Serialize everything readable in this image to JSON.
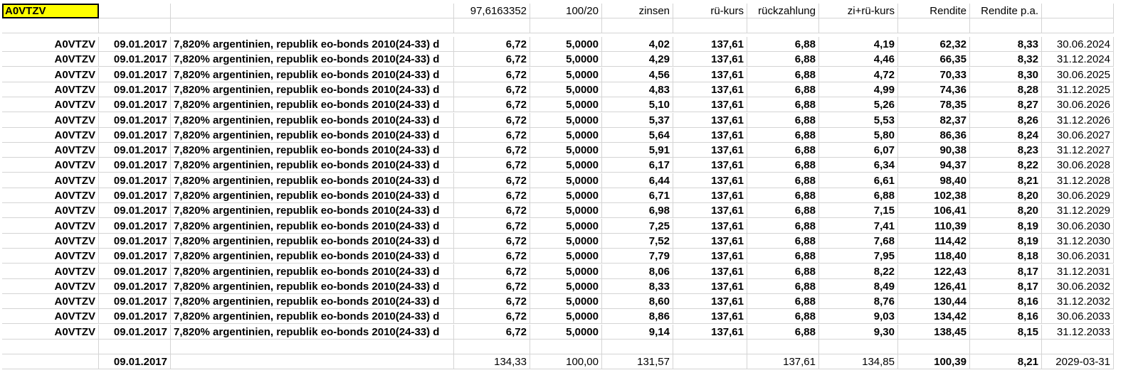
{
  "header": {
    "cells": [
      "A0VTZV",
      "",
      "",
      "97,6163352",
      "100/20",
      "zinsen",
      "rü-kurs",
      "rückzahlung",
      "zi+rü-kurs",
      "Rendite",
      "Rendite p.a.",
      ""
    ],
    "active_cell_fill": "#ffff00"
  },
  "row_template": {
    "wkn": "A0VTZV",
    "date": "09.01.2017",
    "name": "7,820% argentinien, republik eo-bonds 2010(24-33) d",
    "kurs": "6,72",
    "ratio": "5,0000",
    "rue_kurs": "137,61",
    "rueckzahlung": "6,88"
  },
  "rows": [
    {
      "zinsen": "4,02",
      "zi_rue": "4,19",
      "rendite": "62,32",
      "rendite_pa": "8,33",
      "datum": "30.06.2024"
    },
    {
      "zinsen": "4,29",
      "zi_rue": "4,46",
      "rendite": "66,35",
      "rendite_pa": "8,32",
      "datum": "31.12.2024"
    },
    {
      "zinsen": "4,56",
      "zi_rue": "4,72",
      "rendite": "70,33",
      "rendite_pa": "8,30",
      "datum": "30.06.2025"
    },
    {
      "zinsen": "4,83",
      "zi_rue": "4,99",
      "rendite": "74,36",
      "rendite_pa": "8,28",
      "datum": "31.12.2025"
    },
    {
      "zinsen": "5,10",
      "zi_rue": "5,26",
      "rendite": "78,35",
      "rendite_pa": "8,27",
      "datum": "30.06.2026"
    },
    {
      "zinsen": "5,37",
      "zi_rue": "5,53",
      "rendite": "82,37",
      "rendite_pa": "8,26",
      "datum": "31.12.2026"
    },
    {
      "zinsen": "5,64",
      "zi_rue": "5,80",
      "rendite": "86,36",
      "rendite_pa": "8,24",
      "datum": "30.06.2027"
    },
    {
      "zinsen": "5,91",
      "zi_rue": "6,07",
      "rendite": "90,38",
      "rendite_pa": "8,23",
      "datum": "31.12.2027"
    },
    {
      "zinsen": "6,17",
      "zi_rue": "6,34",
      "rendite": "94,37",
      "rendite_pa": "8,22",
      "datum": "30.06.2028"
    },
    {
      "zinsen": "6,44",
      "zi_rue": "6,61",
      "rendite": "98,40",
      "rendite_pa": "8,21",
      "datum": "31.12.2028"
    },
    {
      "zinsen": "6,71",
      "zi_rue": "6,88",
      "rendite": "102,38",
      "rendite_pa": "8,20",
      "datum": "30.06.2029"
    },
    {
      "zinsen": "6,98",
      "zi_rue": "7,15",
      "rendite": "106,41",
      "rendite_pa": "8,20",
      "datum": "31.12.2029"
    },
    {
      "zinsen": "7,25",
      "zi_rue": "7,41",
      "rendite": "110,39",
      "rendite_pa": "8,19",
      "datum": "30.06.2030"
    },
    {
      "zinsen": "7,52",
      "zi_rue": "7,68",
      "rendite": "114,42",
      "rendite_pa": "8,19",
      "datum": "31.12.2030"
    },
    {
      "zinsen": "7,79",
      "zi_rue": "7,95",
      "rendite": "118,40",
      "rendite_pa": "8,18",
      "datum": "30.06.2031"
    },
    {
      "zinsen": "8,06",
      "zi_rue": "8,22",
      "rendite": "122,43",
      "rendite_pa": "8,17",
      "datum": "31.12.2031"
    },
    {
      "zinsen": "8,33",
      "zi_rue": "8,49",
      "rendite": "126,41",
      "rendite_pa": "8,17",
      "datum": "30.06.2032"
    },
    {
      "zinsen": "8,60",
      "zi_rue": "8,76",
      "rendite": "130,44",
      "rendite_pa": "8,16",
      "datum": "31.12.2032"
    },
    {
      "zinsen": "8,86",
      "zi_rue": "9,03",
      "rendite": "134,42",
      "rendite_pa": "8,16",
      "datum": "30.06.2033"
    },
    {
      "zinsen": "9,14",
      "zi_rue": "9,30",
      "rendite": "138,45",
      "rendite_pa": "8,15",
      "datum": "31.12.2033"
    }
  ],
  "totals": {
    "date": "09.01.2017",
    "kurs": "134,33",
    "ratio": "100,00",
    "zinsen": "131,57",
    "rue_kurs": "",
    "rueckzahlung": "137,61",
    "zi_rue": "134,85",
    "rendite": "100,39",
    "rendite_pa": "8,21",
    "datum": "2029-03-31"
  }
}
